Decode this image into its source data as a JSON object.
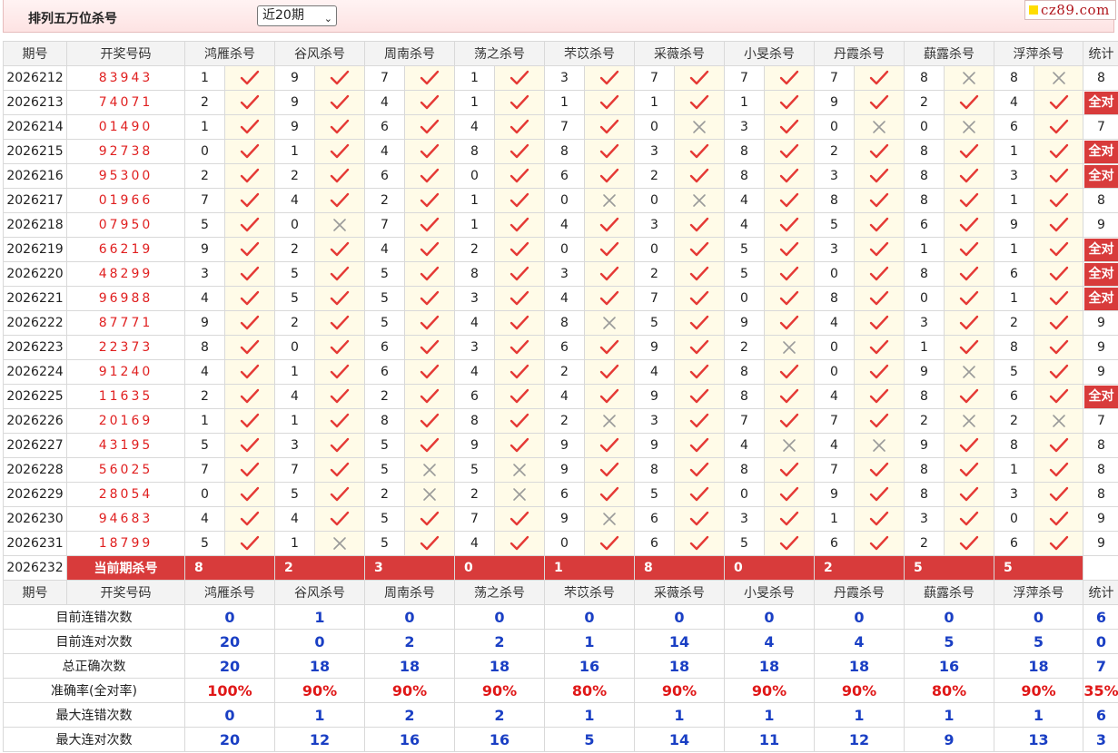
{
  "header": {
    "title": "排列五万位杀号",
    "period_select": "近20期",
    "site_badge": "cz89.com"
  },
  "columns": {
    "issue": "期号",
    "winning": "开奖号码",
    "stat": "统计",
    "experts": [
      "鸿雁杀号",
      "谷风杀号",
      "周南杀号",
      "荡之杀号",
      "芣苡杀号",
      "采薇杀号",
      "小旻杀号",
      "丹霞杀号",
      "蕻露杀号",
      "浮萍杀号"
    ]
  },
  "rows": [
    {
      "issue": "2026212",
      "winning": "83943",
      "k": [
        1,
        9,
        7,
        1,
        3,
        7,
        7,
        7,
        8,
        8
      ],
      "r": [
        1,
        1,
        1,
        1,
        1,
        1,
        1,
        1,
        0,
        0
      ],
      "total": "8"
    },
    {
      "issue": "2026213",
      "winning": "74071",
      "k": [
        2,
        9,
        4,
        1,
        1,
        1,
        1,
        9,
        2,
        4
      ],
      "r": [
        1,
        1,
        1,
        1,
        1,
        1,
        1,
        1,
        1,
        1
      ],
      "total": "全对"
    },
    {
      "issue": "2026214",
      "winning": "01490",
      "k": [
        1,
        9,
        6,
        4,
        7,
        0,
        3,
        0,
        0,
        6
      ],
      "r": [
        1,
        1,
        1,
        1,
        1,
        0,
        1,
        0,
        0,
        1
      ],
      "total": "7"
    },
    {
      "issue": "2026215",
      "winning": "92738",
      "k": [
        0,
        1,
        4,
        8,
        8,
        3,
        8,
        2,
        8,
        1
      ],
      "r": [
        1,
        1,
        1,
        1,
        1,
        1,
        1,
        1,
        1,
        1
      ],
      "total": "全对"
    },
    {
      "issue": "2026216",
      "winning": "95300",
      "k": [
        2,
        2,
        6,
        0,
        6,
        2,
        8,
        3,
        8,
        3
      ],
      "r": [
        1,
        1,
        1,
        1,
        1,
        1,
        1,
        1,
        1,
        1
      ],
      "total": "全对"
    },
    {
      "issue": "2026217",
      "winning": "01966",
      "k": [
        7,
        4,
        2,
        1,
        0,
        0,
        4,
        8,
        8,
        1
      ],
      "r": [
        1,
        1,
        1,
        1,
        0,
        0,
        1,
        1,
        1,
        1
      ],
      "total": "8"
    },
    {
      "issue": "2026218",
      "winning": "07950",
      "k": [
        5,
        0,
        7,
        1,
        4,
        3,
        4,
        5,
        6,
        9
      ],
      "r": [
        1,
        0,
        1,
        1,
        1,
        1,
        1,
        1,
        1,
        1
      ],
      "total": "9"
    },
    {
      "issue": "2026219",
      "winning": "66219",
      "k": [
        9,
        2,
        4,
        2,
        0,
        0,
        5,
        3,
        1,
        1
      ],
      "r": [
        1,
        1,
        1,
        1,
        1,
        1,
        1,
        1,
        1,
        1
      ],
      "total": "全对"
    },
    {
      "issue": "2026220",
      "winning": "48299",
      "k": [
        3,
        5,
        5,
        8,
        3,
        2,
        5,
        0,
        8,
        6
      ],
      "r": [
        1,
        1,
        1,
        1,
        1,
        1,
        1,
        1,
        1,
        1
      ],
      "total": "全对"
    },
    {
      "issue": "2026221",
      "winning": "96988",
      "k": [
        4,
        5,
        5,
        3,
        4,
        7,
        0,
        8,
        0,
        1
      ],
      "r": [
        1,
        1,
        1,
        1,
        1,
        1,
        1,
        1,
        1,
        1
      ],
      "total": "全对"
    },
    {
      "issue": "2026222",
      "winning": "87771",
      "k": [
        9,
        2,
        5,
        4,
        8,
        5,
        9,
        4,
        3,
        2
      ],
      "r": [
        1,
        1,
        1,
        1,
        0,
        1,
        1,
        1,
        1,
        1
      ],
      "total": "9"
    },
    {
      "issue": "2026223",
      "winning": "22373",
      "k": [
        8,
        0,
        6,
        3,
        6,
        9,
        2,
        0,
        1,
        8
      ],
      "r": [
        1,
        1,
        1,
        1,
        1,
        1,
        0,
        1,
        1,
        1
      ],
      "total": "9"
    },
    {
      "issue": "2026224",
      "winning": "91240",
      "k": [
        4,
        1,
        6,
        4,
        2,
        4,
        8,
        0,
        9,
        5
      ],
      "r": [
        1,
        1,
        1,
        1,
        1,
        1,
        1,
        1,
        0,
        1
      ],
      "total": "9"
    },
    {
      "issue": "2026225",
      "winning": "11635",
      "k": [
        2,
        4,
        2,
        6,
        4,
        9,
        8,
        4,
        8,
        6
      ],
      "r": [
        1,
        1,
        1,
        1,
        1,
        1,
        1,
        1,
        1,
        1
      ],
      "total": "全对"
    },
    {
      "issue": "2026226",
      "winning": "20169",
      "k": [
        1,
        1,
        8,
        8,
        2,
        3,
        7,
        7,
        2,
        2
      ],
      "r": [
        1,
        1,
        1,
        1,
        0,
        1,
        1,
        1,
        0,
        0
      ],
      "total": "7"
    },
    {
      "issue": "2026227",
      "winning": "43195",
      "k": [
        5,
        3,
        5,
        9,
        9,
        9,
        4,
        4,
        9,
        8
      ],
      "r": [
        1,
        1,
        1,
        1,
        1,
        1,
        0,
        0,
        1,
        1
      ],
      "total": "8"
    },
    {
      "issue": "2026228",
      "winning": "56025",
      "k": [
        7,
        7,
        5,
        5,
        9,
        8,
        8,
        7,
        8,
        1
      ],
      "r": [
        1,
        1,
        0,
        0,
        1,
        1,
        1,
        1,
        1,
        1
      ],
      "total": "8"
    },
    {
      "issue": "2026229",
      "winning": "28054",
      "k": [
        0,
        5,
        2,
        2,
        6,
        5,
        0,
        9,
        8,
        3
      ],
      "r": [
        1,
        1,
        0,
        0,
        1,
        1,
        1,
        1,
        1,
        1
      ],
      "total": "8"
    },
    {
      "issue": "2026230",
      "winning": "94683",
      "k": [
        4,
        4,
        5,
        7,
        9,
        6,
        3,
        1,
        3,
        0
      ],
      "r": [
        1,
        1,
        1,
        1,
        0,
        1,
        1,
        1,
        1,
        1
      ],
      "total": "9"
    },
    {
      "issue": "2026231",
      "winning": "18799",
      "k": [
        5,
        1,
        5,
        4,
        0,
        6,
        5,
        6,
        2,
        6
      ],
      "r": [
        1,
        0,
        1,
        1,
        1,
        1,
        1,
        1,
        1,
        1
      ],
      "total": "9"
    }
  ],
  "current": {
    "issue": "2026232",
    "label": "当前期杀号",
    "kills": [
      "8",
      "2",
      "3",
      "0",
      "1",
      "8",
      "0",
      "2",
      "5",
      "5"
    ]
  },
  "stats": [
    {
      "label": "目前连错次数",
      "values": [
        "0",
        "1",
        "0",
        "0",
        "0",
        "0",
        "0",
        "0",
        "0",
        "0"
      ],
      "total": "6"
    },
    {
      "label": "目前连对次数",
      "values": [
        "20",
        "0",
        "2",
        "2",
        "1",
        "14",
        "4",
        "4",
        "5",
        "5"
      ],
      "total": "0"
    },
    {
      "label": "总正确次数",
      "values": [
        "20",
        "18",
        "18",
        "18",
        "16",
        "18",
        "18",
        "18",
        "16",
        "18"
      ],
      "total": "7"
    },
    {
      "label": "准确率(全对率)",
      "values": [
        "100%",
        "90%",
        "90%",
        "90%",
        "80%",
        "90%",
        "90%",
        "90%",
        "80%",
        "90%"
      ],
      "total": "35%"
    },
    {
      "label": "最大连错次数",
      "values": [
        "0",
        "1",
        "2",
        "2",
        "1",
        "1",
        "1",
        "1",
        "1",
        "1"
      ],
      "total": "6"
    },
    {
      "label": "最大连对次数",
      "values": [
        "20",
        "12",
        "16",
        "16",
        "5",
        "14",
        "11",
        "12",
        "9",
        "13"
      ],
      "total": "3"
    }
  ],
  "colors": {
    "check": "#e53935",
    "cross": "#9a9a9a",
    "accent": "#d83b3b",
    "stat_blue": "#1a3fc4"
  }
}
